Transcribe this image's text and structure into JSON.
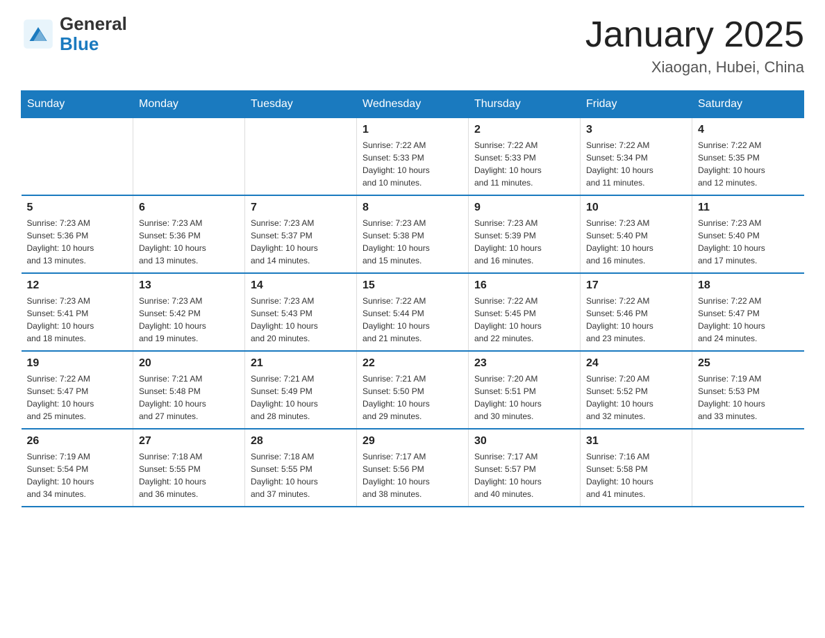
{
  "header": {
    "title": "January 2025",
    "subtitle": "Xiaogan, Hubei, China",
    "logo_general": "General",
    "logo_blue": "Blue"
  },
  "days_of_week": [
    "Sunday",
    "Monday",
    "Tuesday",
    "Wednesday",
    "Thursday",
    "Friday",
    "Saturday"
  ],
  "weeks": [
    [
      {
        "day": "",
        "info": ""
      },
      {
        "day": "",
        "info": ""
      },
      {
        "day": "",
        "info": ""
      },
      {
        "day": "1",
        "info": "Sunrise: 7:22 AM\nSunset: 5:33 PM\nDaylight: 10 hours\nand 10 minutes."
      },
      {
        "day": "2",
        "info": "Sunrise: 7:22 AM\nSunset: 5:33 PM\nDaylight: 10 hours\nand 11 minutes."
      },
      {
        "day": "3",
        "info": "Sunrise: 7:22 AM\nSunset: 5:34 PM\nDaylight: 10 hours\nand 11 minutes."
      },
      {
        "day": "4",
        "info": "Sunrise: 7:22 AM\nSunset: 5:35 PM\nDaylight: 10 hours\nand 12 minutes."
      }
    ],
    [
      {
        "day": "5",
        "info": "Sunrise: 7:23 AM\nSunset: 5:36 PM\nDaylight: 10 hours\nand 13 minutes."
      },
      {
        "day": "6",
        "info": "Sunrise: 7:23 AM\nSunset: 5:36 PM\nDaylight: 10 hours\nand 13 minutes."
      },
      {
        "day": "7",
        "info": "Sunrise: 7:23 AM\nSunset: 5:37 PM\nDaylight: 10 hours\nand 14 minutes."
      },
      {
        "day": "8",
        "info": "Sunrise: 7:23 AM\nSunset: 5:38 PM\nDaylight: 10 hours\nand 15 minutes."
      },
      {
        "day": "9",
        "info": "Sunrise: 7:23 AM\nSunset: 5:39 PM\nDaylight: 10 hours\nand 16 minutes."
      },
      {
        "day": "10",
        "info": "Sunrise: 7:23 AM\nSunset: 5:40 PM\nDaylight: 10 hours\nand 16 minutes."
      },
      {
        "day": "11",
        "info": "Sunrise: 7:23 AM\nSunset: 5:40 PM\nDaylight: 10 hours\nand 17 minutes."
      }
    ],
    [
      {
        "day": "12",
        "info": "Sunrise: 7:23 AM\nSunset: 5:41 PM\nDaylight: 10 hours\nand 18 minutes."
      },
      {
        "day": "13",
        "info": "Sunrise: 7:23 AM\nSunset: 5:42 PM\nDaylight: 10 hours\nand 19 minutes."
      },
      {
        "day": "14",
        "info": "Sunrise: 7:23 AM\nSunset: 5:43 PM\nDaylight: 10 hours\nand 20 minutes."
      },
      {
        "day": "15",
        "info": "Sunrise: 7:22 AM\nSunset: 5:44 PM\nDaylight: 10 hours\nand 21 minutes."
      },
      {
        "day": "16",
        "info": "Sunrise: 7:22 AM\nSunset: 5:45 PM\nDaylight: 10 hours\nand 22 minutes."
      },
      {
        "day": "17",
        "info": "Sunrise: 7:22 AM\nSunset: 5:46 PM\nDaylight: 10 hours\nand 23 minutes."
      },
      {
        "day": "18",
        "info": "Sunrise: 7:22 AM\nSunset: 5:47 PM\nDaylight: 10 hours\nand 24 minutes."
      }
    ],
    [
      {
        "day": "19",
        "info": "Sunrise: 7:22 AM\nSunset: 5:47 PM\nDaylight: 10 hours\nand 25 minutes."
      },
      {
        "day": "20",
        "info": "Sunrise: 7:21 AM\nSunset: 5:48 PM\nDaylight: 10 hours\nand 27 minutes."
      },
      {
        "day": "21",
        "info": "Sunrise: 7:21 AM\nSunset: 5:49 PM\nDaylight: 10 hours\nand 28 minutes."
      },
      {
        "day": "22",
        "info": "Sunrise: 7:21 AM\nSunset: 5:50 PM\nDaylight: 10 hours\nand 29 minutes."
      },
      {
        "day": "23",
        "info": "Sunrise: 7:20 AM\nSunset: 5:51 PM\nDaylight: 10 hours\nand 30 minutes."
      },
      {
        "day": "24",
        "info": "Sunrise: 7:20 AM\nSunset: 5:52 PM\nDaylight: 10 hours\nand 32 minutes."
      },
      {
        "day": "25",
        "info": "Sunrise: 7:19 AM\nSunset: 5:53 PM\nDaylight: 10 hours\nand 33 minutes."
      }
    ],
    [
      {
        "day": "26",
        "info": "Sunrise: 7:19 AM\nSunset: 5:54 PM\nDaylight: 10 hours\nand 34 minutes."
      },
      {
        "day": "27",
        "info": "Sunrise: 7:18 AM\nSunset: 5:55 PM\nDaylight: 10 hours\nand 36 minutes."
      },
      {
        "day": "28",
        "info": "Sunrise: 7:18 AM\nSunset: 5:55 PM\nDaylight: 10 hours\nand 37 minutes."
      },
      {
        "day": "29",
        "info": "Sunrise: 7:17 AM\nSunset: 5:56 PM\nDaylight: 10 hours\nand 38 minutes."
      },
      {
        "day": "30",
        "info": "Sunrise: 7:17 AM\nSunset: 5:57 PM\nDaylight: 10 hours\nand 40 minutes."
      },
      {
        "day": "31",
        "info": "Sunrise: 7:16 AM\nSunset: 5:58 PM\nDaylight: 10 hours\nand 41 minutes."
      },
      {
        "day": "",
        "info": ""
      }
    ]
  ]
}
